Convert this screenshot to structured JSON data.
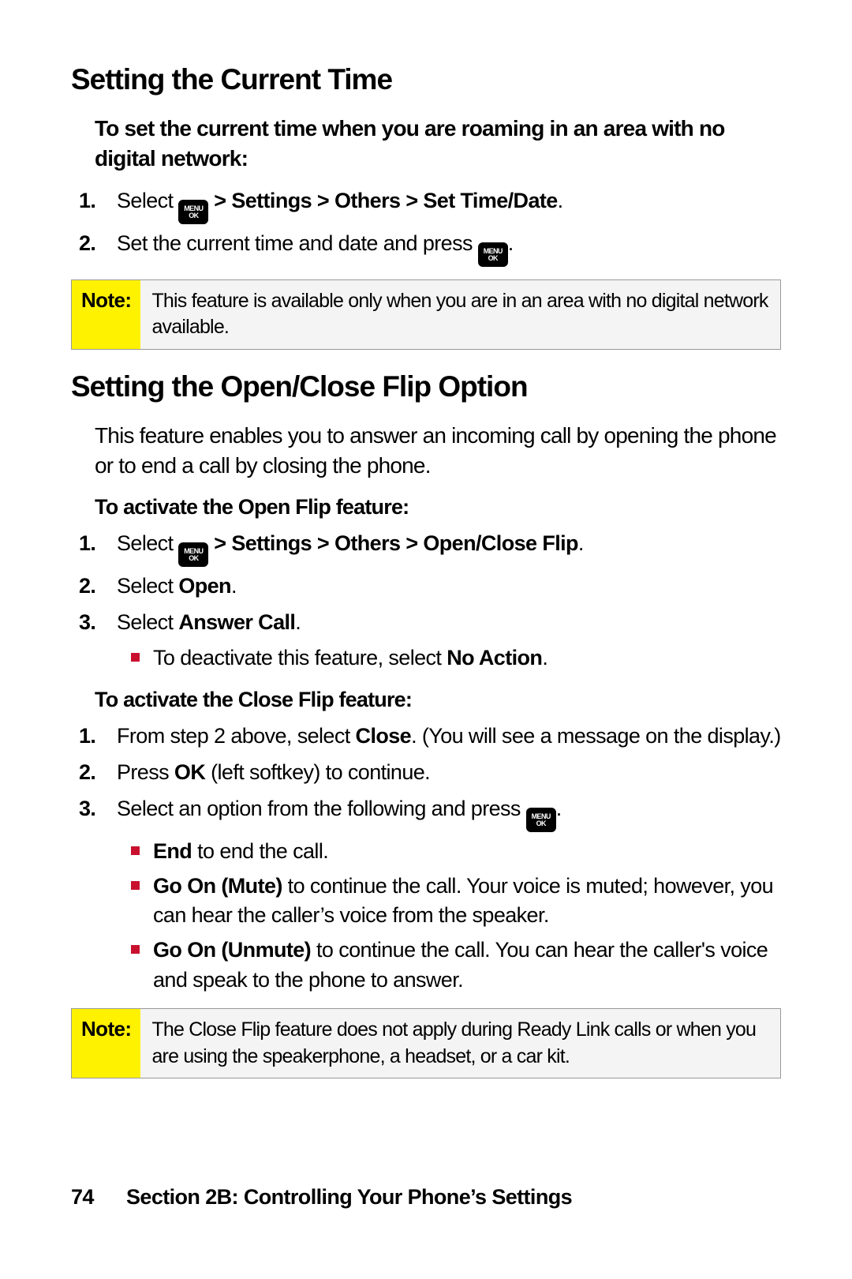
{
  "section1": {
    "heading": "Setting the Current Time",
    "intro": "To set the current time when you are roaming in an area with no digital network:",
    "step1_pre": "Select ",
    "step1_post": " > Settings > Others > Set Time/Date",
    "step1_end": ".",
    "step2_pre": "Set the current time and date and press ",
    "step2_end": "."
  },
  "note1": {
    "label": "Note:",
    "text": "This feature is available only when you are in an area with no digital network available."
  },
  "section2": {
    "heading": "Setting the Open/Close Flip Option",
    "intro": "This feature enables you to answer an incoming call by opening the phone or to end a call by closing the phone.",
    "sub1": "To activate the Open Flip feature:",
    "s1_step1_pre": "Select ",
    "s1_step1_post": " > Settings > Others > Open/Close Flip",
    "s1_step1_end": ".",
    "s1_step2_pre": "Select ",
    "s1_step2_bold": "Open",
    "s1_step2_end": ".",
    "s1_step3_pre": "Select ",
    "s1_step3_bold": "Answer Call",
    "s1_step3_end": ".",
    "s1_bullet_pre": "To deactivate this feature, select ",
    "s1_bullet_bold": "No Action",
    "s1_bullet_end": ".",
    "sub2": "To activate the Close Flip feature:",
    "s2_step1_pre": "From step 2 above, select ",
    "s2_step1_bold": "Close",
    "s2_step1_post": ". (You will see a message on the display.)",
    "s2_step2_pre": "Press ",
    "s2_step2_bold": "OK",
    "s2_step2_post": " (left softkey) to continue.",
    "s2_step3_pre": "Select an option from the following and press ",
    "s2_step3_end": ".",
    "b1_bold": "End",
    "b1_post": " to end the call.",
    "b2_bold": "Go On (Mute)",
    "b2_post": " to continue the call. Your voice is muted; however, you can hear the caller’s voice from the speaker.",
    "b3_bold": "Go On (Unmute)",
    "b3_post": " to continue the call. You can hear the caller's voice and speak to the phone to answer."
  },
  "note2": {
    "label": "Note:",
    "text": "The Close Flip feature does not apply during Ready Link calls or when you are using the speakerphone, a headset, or a car kit."
  },
  "footer": {
    "page": "74",
    "title": "Section 2B: Controlling Your Phone’s Settings"
  },
  "icon": {
    "top": "MENU",
    "bot": "OK"
  }
}
